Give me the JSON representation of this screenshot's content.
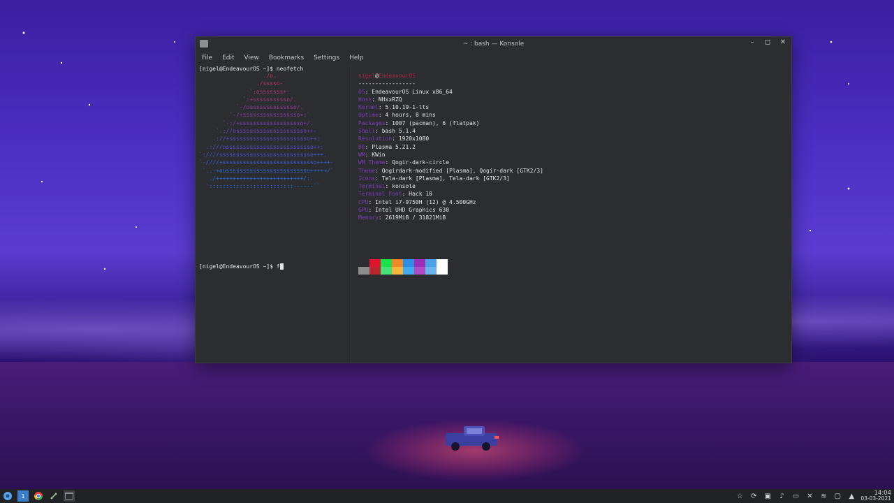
{
  "window": {
    "title": "~ : bash — Konsole",
    "controls": {
      "minimize": "–",
      "maximize": "◻",
      "close": "✕"
    }
  },
  "menu": [
    "File",
    "Edit",
    "View",
    "Bookmarks",
    "Settings",
    "Help"
  ],
  "terminal": {
    "prompt1": "[nigel@EndeavourOS ~]$ neofetch",
    "logo_lines": [
      "                   ./o.",
      "                 ./sssso-",
      "               `:osssssss+-",
      "             `:+sssssssssso/.",
      "           `-/ossssssssssssso/.",
      "         `-/+sssssssssssssssso+:`",
      "       `-:/+sssssssssssssssssso+/.",
      "     `.://osssssssssssssssssssso++-",
      "    .://+ssssssssssssssssssssssso++:",
      "  .:///ossssssssssssssssssssssssso++:",
      "`:////ssssssssssssssssssssssssssso+++.",
      "`-////+ssssssssssssssssssssssssssso++++-",
      " `..-+oosssssssssssssssssssssssso+++++/`",
      "   ./++++++++++++++++++++++++++/:.",
      "  `:::::::::::::::::::::::::------``"
    ],
    "user_host": {
      "user": "nigel",
      "at": "@",
      "host": "EndeavourOS"
    },
    "separator": "-----------------",
    "info": [
      {
        "label": "OS",
        "value": "EndeavourOS Linux x86_64"
      },
      {
        "label": "Host",
        "value": "NHxxRZQ"
      },
      {
        "label": "Kernel",
        "value": "5.10.19-1-lts"
      },
      {
        "label": "Uptime",
        "value": "4 hours, 8 mins"
      },
      {
        "label": "Packages",
        "value": "1007 (pacman), 6 (flatpak)"
      },
      {
        "label": "Shell",
        "value": "bash 5.1.4"
      },
      {
        "label": "Resolution",
        "value": "1920x1080"
      },
      {
        "label": "DE",
        "value": "Plasma 5.21.2"
      },
      {
        "label": "WM",
        "value": "KWin"
      },
      {
        "label": "WM Theme",
        "value": "Qogir-dark-circle"
      },
      {
        "label": "Theme",
        "value": "Qogirdark-modified [Plasma], Qogir-dark [GTK2/3]"
      },
      {
        "label": "Icons",
        "value": "Tela-dark [Plasma], Tela-dark [GTK2/3]"
      },
      {
        "label": "Terminal",
        "value": "konsole"
      },
      {
        "label": "Terminal Font",
        "value": "Hack 10"
      },
      {
        "label": "CPU",
        "value": "Intel i7-9750H (12) @ 4.500GHz"
      },
      {
        "label": "GPU",
        "value": "Intel UHD Graphics 630"
      },
      {
        "label": "Memory",
        "value": "2619MiB / 31821MiB"
      }
    ],
    "palette_top": [
      "#2b2d31",
      "#e0142c",
      "#19e24b",
      "#f0892a",
      "#2f8fe6",
      "#9b2fb8",
      "#4ca3e8",
      "#ffffff"
    ],
    "palette_bottom": [
      "#8c8c8c",
      "#b8262f",
      "#44e07a",
      "#f5b63e",
      "#44aaf0",
      "#b04cc8",
      "#6ab4f0",
      "#ffffff"
    ],
    "prompt2": "[nigel@EndeavourOS ~]$ f"
  },
  "taskbar": {
    "icons": [
      "app-launcher-icon",
      "virtual-desktop-icon",
      "chrome-icon",
      "tools-icon",
      "konsole-icon"
    ],
    "tray_icons": [
      "star-icon",
      "update-icon",
      "clipboard-icon",
      "volume-icon",
      "battery-icon",
      "mic-muted-icon",
      "wifi-icon",
      "monitor-icon",
      "expand-tray-icon"
    ],
    "time": "14:04",
    "date": "03-03-2021"
  },
  "colors": {
    "label": "#7c3db8",
    "user": "#b02848",
    "window_bg": "#2b2d31"
  }
}
